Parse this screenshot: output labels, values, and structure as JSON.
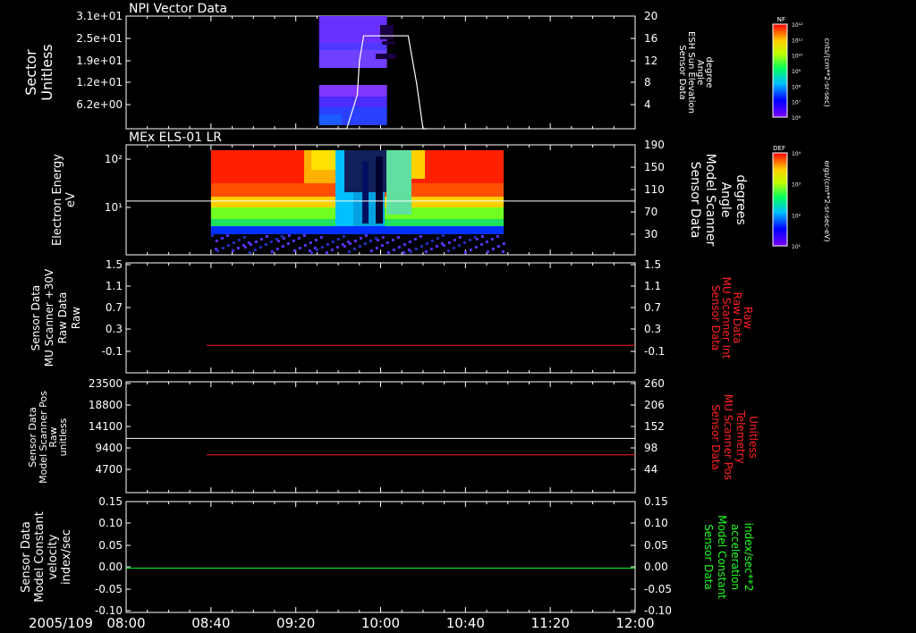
{
  "date": "2005/109",
  "x_ticks": [
    "08:00",
    "08:40",
    "09:20",
    "10:00",
    "10:40",
    "11:20",
    "12:00"
  ],
  "x_range_minutes": [
    480,
    720
  ],
  "panels": [
    {
      "title": "NPI Vector Data",
      "left_label": [
        "Sector",
        "Unitless"
      ],
      "left_ticks": [
        "3.1e+01",
        "2.5e+01",
        "1.9e+01",
        "1.2e+01",
        "6.2e+00"
      ],
      "right_label": [
        "Sensor Data",
        "ESH Sun Elevation",
        "Angle",
        "degree"
      ],
      "right_ticks": [
        "20",
        "16",
        "12",
        "8",
        "4"
      ],
      "right_color": "#ffffff"
    },
    {
      "title": "MEx ELS-01 LR",
      "left_label": [
        "Electron Energy",
        "eV"
      ],
      "left_ticks": [
        "10²",
        "10¹"
      ],
      "right_label": [
        "Sensor Data",
        "Model Scanner",
        "Angle",
        "degrees"
      ],
      "right_ticks": [
        "190",
        "150",
        "110",
        "70",
        "30"
      ],
      "right_color": "#ffffff"
    },
    {
      "title": "",
      "left_label": [
        "Sensor Data",
        "MU Scanner +30V",
        "Raw Data",
        "Raw"
      ],
      "left_ticks": [
        "1.5",
        "1.1",
        "0.7",
        "0.3",
        "-0.1"
      ],
      "right_label": [
        "Sensor Data",
        "MU Scanner Int",
        "Raw Data",
        "Raw"
      ],
      "right_ticks": [
        "1.5",
        "1.1",
        "0.7",
        "0.3",
        "-0.1"
      ],
      "right_color": "#ff2020"
    },
    {
      "title": "",
      "left_label": [
        "Sensor Data",
        "Model Scanner Pos",
        "Raw",
        "unitless"
      ],
      "left_ticks": [
        "23500",
        "18800",
        "14100",
        "9400",
        "4700"
      ],
      "right_label": [
        "Sensor Data",
        "MU Scanner Pos",
        "Telemetry",
        "Unitless"
      ],
      "right_ticks": [
        "260",
        "206",
        "152",
        "98",
        "44"
      ],
      "right_color": "#ff2020"
    },
    {
      "title": "",
      "left_label": [
        "Sensor Data",
        "Model Constant",
        "velocity",
        "index/sec"
      ],
      "left_ticks": [
        "0.15",
        "0.10",
        "0.05",
        "0.00",
        "-0.05",
        "-0.10"
      ],
      "right_label": [
        "Sensor Data",
        "Model Constant",
        "acceleration",
        "index/sec**2"
      ],
      "right_ticks": [
        "0.15",
        "0.10",
        "0.05",
        "0.00",
        "-0.05",
        "-0.10"
      ],
      "right_color": "#20ff20"
    }
  ],
  "colorbars": [
    {
      "label": "NF",
      "unit": "cnts/(cm**2-sr-sec)",
      "ticks": [
        "10¹²",
        "10¹¹",
        "10¹⁰",
        "10⁹",
        "10⁸",
        "10⁷",
        "10⁶"
      ]
    },
    {
      "label": "DEF",
      "unit": "ergs/(cm**2-sr-sec-eV)",
      "ticks": [
        "10⁴",
        "10³",
        "10²",
        "10¹"
      ]
    }
  ],
  "chart_data": [
    {
      "type": "heatmap",
      "title": "NPI Vector Data",
      "ylabel": "Sector Unitless",
      "x_start_minutes": 571,
      "x_end_minutes": 603,
      "overlay_line": {
        "name": "ESH Sun Elevation Angle",
        "color": "#ffffff",
        "points": [
          [
            571,
            0
          ],
          [
            584,
            0
          ],
          [
            589,
            6
          ],
          [
            590,
            12
          ],
          [
            592,
            16.5
          ],
          [
            613,
            16.5
          ],
          [
            617,
            8
          ],
          [
            620,
            0
          ],
          [
            622,
            0
          ]
        ],
        "ylim": [
          0,
          20
        ]
      }
    },
    {
      "type": "heatmap",
      "title": "MEx ELS-01 LR",
      "ylabel": "Electron Energy eV",
      "x_start_minutes": 520,
      "x_end_minutes": 658,
      "overlay_line": {
        "name": "Model Scanner Angle",
        "color": "#ffffff",
        "value": 98,
        "ylim": [
          10,
          190
        ]
      }
    },
    {
      "type": "line",
      "series": [
        {
          "color": "#ff2020",
          "x": [
            518,
            720
          ],
          "y": [
            0.0,
            0.0
          ]
        }
      ],
      "ylim": [
        -0.5,
        1.5
      ]
    },
    {
      "type": "line",
      "series": [
        {
          "color": "#ff2020",
          "x": [
            518,
            720
          ],
          "y": [
            8000,
            8000
          ]
        },
        {
          "color": "#ffffff",
          "x": [
            480,
            720
          ],
          "y": [
            11500,
            11500
          ]
        }
      ],
      "ylim": [
        0,
        23500
      ]
    },
    {
      "type": "line",
      "series": [
        {
          "color": "#20ff20",
          "x": [
            480,
            720
          ],
          "y": [
            0.0,
            0.0
          ]
        }
      ],
      "ylim": [
        -0.1,
        0.15
      ]
    }
  ]
}
